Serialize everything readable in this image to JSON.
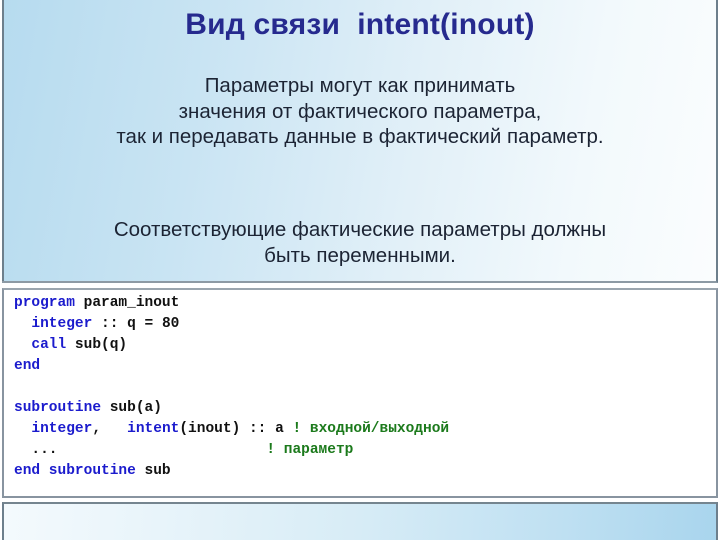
{
  "slide": {
    "title": "Вид связи  intent(inout)",
    "paragraph_1": "Параметры могут как принимать\nзначения от фактического параметра,\nтак и передавать данные в фактический параметр.",
    "paragraph_2": "Соответствующие фактические параметры должны\nбыть переменными.",
    "colors": {
      "title": "#262a8e",
      "body_text": "#1c2434",
      "code_keyword": "#1b1bcd",
      "code_plain": "#111111",
      "code_comment": "#1c7a1c",
      "panel_border": "#8894a0",
      "gradient_start": "#b6dbef",
      "gradient_end": "#fbfdfe"
    }
  },
  "code": {
    "language": "Fortran",
    "lines": [
      [
        {
          "t": "program",
          "c": "kw"
        },
        {
          "t": " param_inout",
          "c": "pl"
        }
      ],
      [
        {
          "t": "  ",
          "c": "pl"
        },
        {
          "t": "integer",
          "c": "kw"
        },
        {
          "t": " :: q = 80",
          "c": "pl"
        }
      ],
      [
        {
          "t": "  ",
          "c": "pl"
        },
        {
          "t": "call",
          "c": "kw"
        },
        {
          "t": " sub(q)",
          "c": "pl"
        }
      ],
      [
        {
          "t": "end",
          "c": "kw"
        }
      ],
      [
        {
          "t": "",
          "c": "pl"
        }
      ],
      [
        {
          "t": "subroutine",
          "c": "kw"
        },
        {
          "t": " sub(a)",
          "c": "pl"
        }
      ],
      [
        {
          "t": "  ",
          "c": "pl"
        },
        {
          "t": "integer",
          "c": "kw"
        },
        {
          "t": ",   ",
          "c": "pl"
        },
        {
          "t": "intent",
          "c": "kw"
        },
        {
          "t": "(inout) :: a ",
          "c": "pl"
        },
        {
          "t": "! входной/выходной",
          "c": "cm"
        }
      ],
      [
        {
          "t": "  ...                        ",
          "c": "pl"
        },
        {
          "t": "! параметр",
          "c": "cm"
        }
      ],
      [
        {
          "t": "end subroutine",
          "c": "kw"
        },
        {
          "t": " sub",
          "c": "pl"
        }
      ]
    ]
  }
}
